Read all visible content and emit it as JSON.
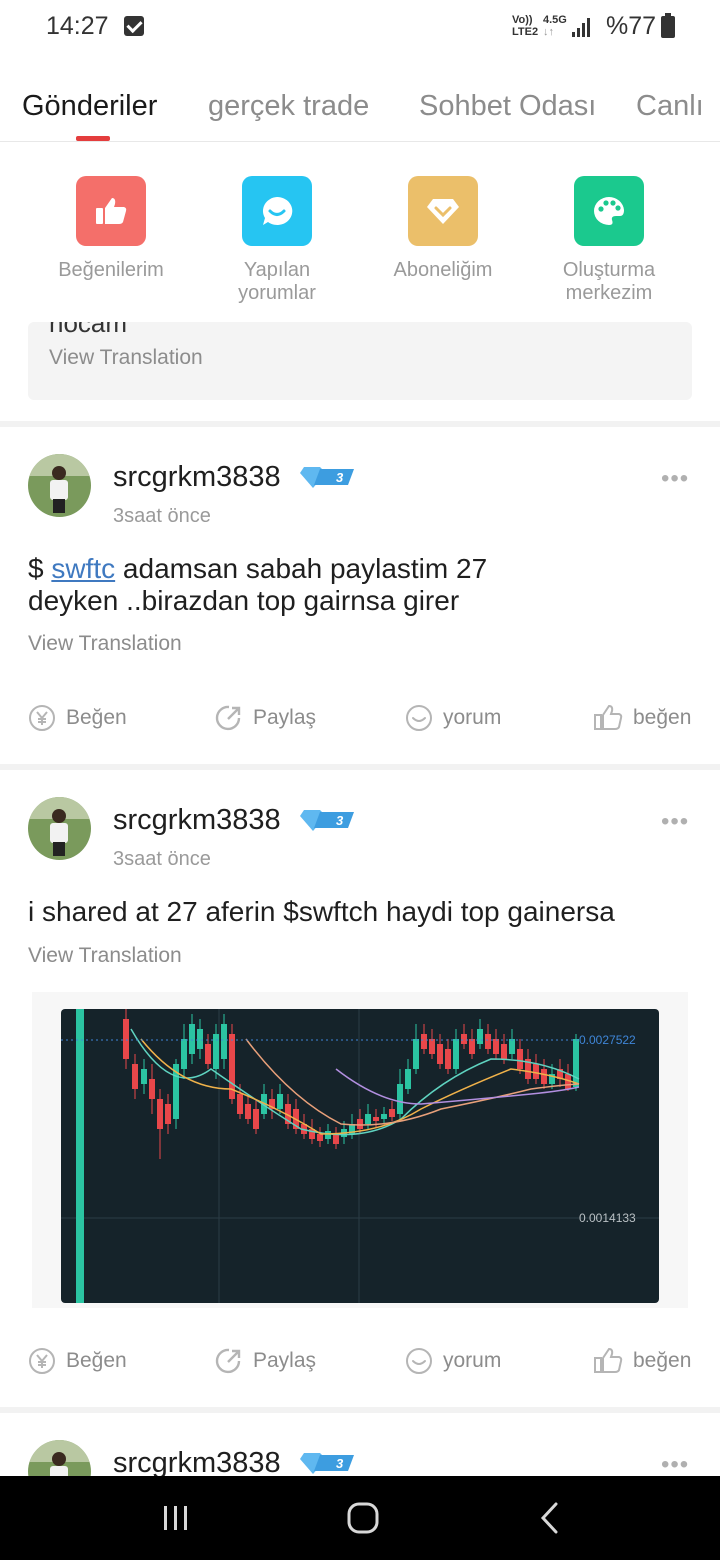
{
  "status_bar": {
    "time": "14:27",
    "network_top": "Vo))",
    "network_bottom": "LTE2",
    "speed": "4.5G",
    "battery": "%77",
    "icons": [
      "checkbox-notification-icon",
      "signal-icon",
      "battery-icon"
    ]
  },
  "tabs": [
    {
      "label": "Gönderiler",
      "active": true
    },
    {
      "label": "gerçek trade",
      "active": false
    },
    {
      "label": "Sohbet Odası",
      "active": false
    },
    {
      "label": "Canlı",
      "active": false
    }
  ],
  "shortcuts": [
    {
      "label_line1": "Beğenilerim",
      "label_line2": "",
      "color": "#f46f6a",
      "icon": "thumbs-up-icon"
    },
    {
      "label_line1": "Yapılan",
      "label_line2": "yorumlar",
      "color": "#26c5f2",
      "icon": "comment-icon"
    },
    {
      "label_line1": "Aboneliğim",
      "label_line2": "",
      "color": "#ebbf6a",
      "icon": "diamond-icon"
    },
    {
      "label_line1": "Oluşturma",
      "label_line2": "merkezim",
      "color": "#1bc98e",
      "icon": "palette-icon"
    }
  ],
  "quoted": {
    "cut_text": "hocam",
    "translate": "View Translation"
  },
  "posts": [
    {
      "username": "srcgrkm3838",
      "badge_level": "3",
      "time": "3saat önce",
      "text_prefix": "$ ",
      "ticker": "swftc",
      "text_line1_rest": " adamsan sabah paylastim 27",
      "text_line2": "deyken ..birazdan top gairnsa girer",
      "translate": "View Translation"
    },
    {
      "username": "srcgrkm3838",
      "badge_level": "3",
      "time": "3saat önce",
      "text": "i shared at 27 aferin $swftch haydi top gainersa",
      "translate": "View Translation",
      "chart": {
        "price_top": "0.0027522",
        "price_bottom": "0.0014133",
        "accent_up": "#2bc4a2",
        "accent_down": "#e8474a"
      }
    },
    {
      "username": "srcgrkm3838",
      "badge_level": "3"
    }
  ],
  "actions": {
    "tip": "Beğen",
    "share": "Paylaş",
    "comment": "yorum",
    "like": "beğen"
  }
}
